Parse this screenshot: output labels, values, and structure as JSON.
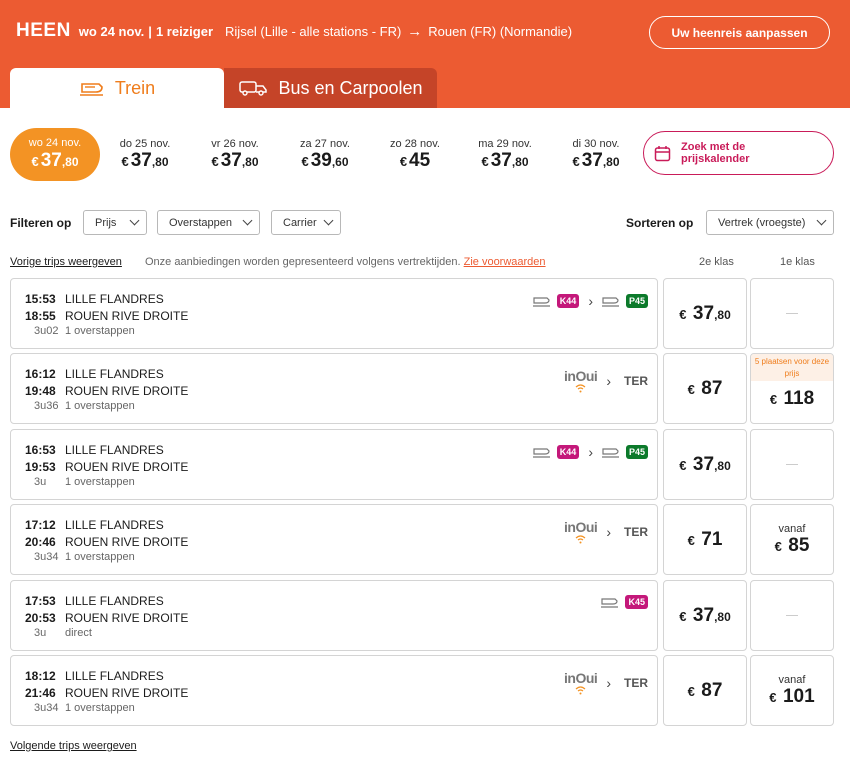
{
  "header": {
    "direction": "HEEN",
    "date": "wo 24 nov.",
    "separator": "|",
    "travelers": "1 reiziger",
    "from": "Rijsel (Lille - alle stations - FR)",
    "arrow": "→",
    "to": "Rouen (FR) (Normandie)",
    "adjust_label": "Uw heenreis aanpassen",
    "color": "#ec5b32"
  },
  "tabs": {
    "train": "Trein",
    "bus": "Bus en Carpoolen"
  },
  "dates": {
    "selected": {
      "day": "wo 24 nov.",
      "euro": "€",
      "price": "37",
      "cents": ",80"
    },
    "others": [
      {
        "day": "do 25 nov.",
        "euro": "€",
        "price": "37",
        "cents": ",80"
      },
      {
        "day": "vr 26 nov.",
        "euro": "€",
        "price": "37",
        "cents": ",80"
      },
      {
        "day": "za 27 nov.",
        "euro": "€",
        "price": "39",
        "cents": ",60"
      },
      {
        "day": "zo 28 nov.",
        "euro": "€",
        "price": "45",
        "cents": ""
      },
      {
        "day": "ma 29 nov.",
        "euro": "€",
        "price": "37",
        "cents": ",80"
      },
      {
        "day": "di 30 nov.",
        "euro": "€",
        "price": "37",
        "cents": ",80"
      }
    ],
    "calendar_label_1": "Zoek met de",
    "calendar_label_2": "prijskalender"
  },
  "filters": {
    "label": "Filteren op",
    "price": "Prijs",
    "transfers": "Overstappen",
    "carrier": "Carrier",
    "sort_label": "Sorteren op",
    "sort_value": "Vertrek (vroegste)"
  },
  "list": {
    "prev": "Vorige trips weergeven",
    "notice": "Onze aanbiedingen worden gepresenteerd volgens vertrektijden.",
    "terms": "Zie voorwaarden",
    "class2": "2e klas",
    "class1": "1e klas",
    "next": "Volgende trips weergeven"
  },
  "trips": [
    {
      "dep": "15:53",
      "arr": "18:55",
      "from": "LILLE FLANDRES",
      "to": "ROUEN RIVE DROITE",
      "duration": "3u02",
      "transfers": "1 overstappen",
      "type": "ter",
      "badges": [
        {
          "text": "K44",
          "color": "#c4187a"
        },
        {
          "text": "P45",
          "color": "#0c7a2b"
        }
      ],
      "price2": {
        "euro": "€",
        "price": "37",
        "cents": ",80"
      },
      "price1": null
    },
    {
      "dep": "16:12",
      "arr": "19:48",
      "from": "LILLE FLANDRES",
      "to": "ROUEN RIVE DROITE",
      "duration": "3u36",
      "transfers": "1 overstappen",
      "type": "inoui",
      "inoui": "inOui",
      "ter": "TER",
      "price2": {
        "euro": "€",
        "price": "87",
        "cents": ""
      },
      "price1": {
        "label": "",
        "note": "5 plaatsen voor deze prijs",
        "euro": "€",
        "price": "118"
      }
    },
    {
      "dep": "16:53",
      "arr": "19:53",
      "from": "LILLE FLANDRES",
      "to": "ROUEN RIVE DROITE",
      "duration": "3u",
      "transfers": "1 overstappen",
      "type": "ter",
      "badges": [
        {
          "text": "K44",
          "color": "#c4187a"
        },
        {
          "text": "P45",
          "color": "#0c7a2b"
        }
      ],
      "price2": {
        "euro": "€",
        "price": "37",
        "cents": ",80"
      },
      "price1": null
    },
    {
      "dep": "17:12",
      "arr": "20:46",
      "from": "LILLE FLANDRES",
      "to": "ROUEN RIVE DROITE",
      "duration": "3u34",
      "transfers": "1 overstappen",
      "type": "inoui",
      "inoui": "inOui",
      "ter": "TER",
      "price2": {
        "euro": "€",
        "price": "71",
        "cents": ""
      },
      "price1": {
        "label": "vanaf",
        "note": "",
        "euro": "€",
        "price": "85"
      }
    },
    {
      "dep": "17:53",
      "arr": "20:53",
      "from": "LILLE FLANDRES",
      "to": "ROUEN RIVE DROITE",
      "duration": "3u",
      "transfers": "direct",
      "type": "ter-single",
      "badges": [
        {
          "text": "K45",
          "color": "#c4187a"
        }
      ],
      "price2": {
        "euro": "€",
        "price": "37",
        "cents": ",80"
      },
      "price1": null
    },
    {
      "dep": "18:12",
      "arr": "21:46",
      "from": "LILLE FLANDRES",
      "to": "ROUEN RIVE DROITE",
      "duration": "3u34",
      "transfers": "1 overstappen",
      "type": "inoui",
      "inoui": "inOui",
      "ter": "TER",
      "price2": {
        "euro": "€",
        "price": "87",
        "cents": ""
      },
      "price1": {
        "label": "vanaf",
        "note": "",
        "euro": "€",
        "price": "101"
      }
    }
  ]
}
